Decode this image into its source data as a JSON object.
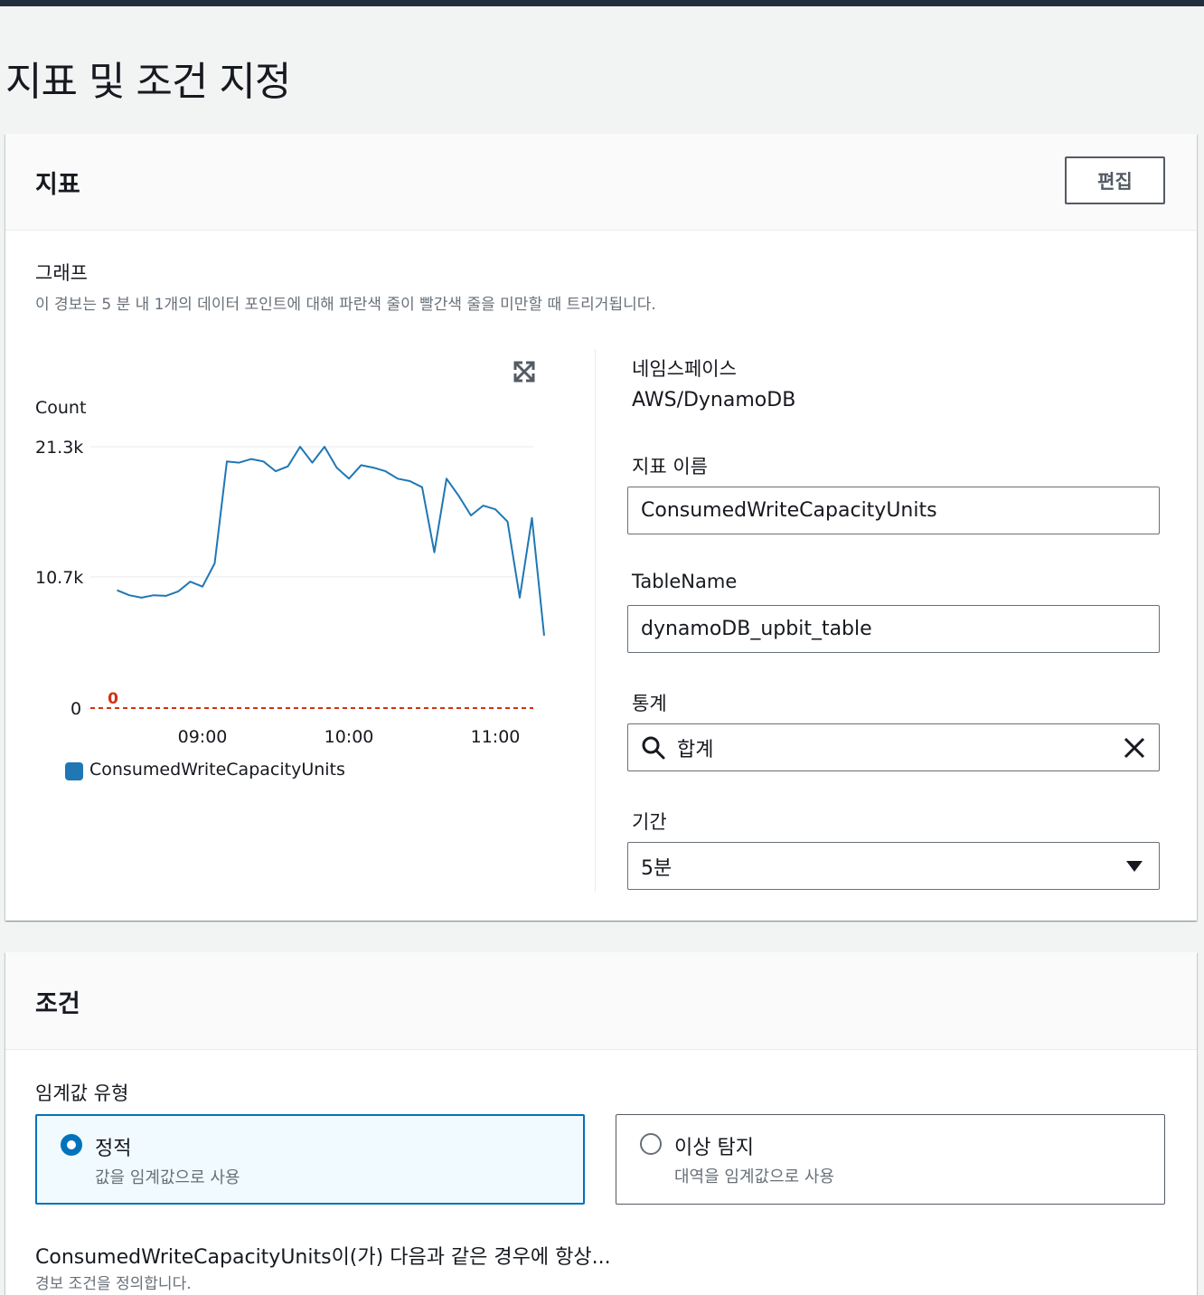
{
  "page": {
    "title": "지표 및 조건 지정"
  },
  "metric_panel": {
    "title": "지표",
    "edit_button": "편집",
    "graph_label": "그래프",
    "graph_description": "이 경보는 5 분 내 1개의 데이터 포인트에 대해 파란색 줄이 빨간색 줄을 미만할 때 트리거됩니다.",
    "expand_icon": "expand-icon",
    "namespace_label": "네임스페이스",
    "namespace_value": "AWS/DynamoDB",
    "metric_name_label": "지표 이름",
    "metric_name_value": "ConsumedWriteCapacityUnits",
    "table_name_label": "TableName",
    "table_name_value": "dynamoDB_upbit_table",
    "statistic_label": "통계",
    "statistic_value": "합계",
    "period_label": "기간",
    "period_value": "5분"
  },
  "chart_data": {
    "type": "line",
    "ylabel": "Count",
    "ytick_labels": [
      "21.3k",
      "10.7k",
      "0"
    ],
    "ylim": [
      0,
      21300
    ],
    "xtick_labels": [
      "09:00",
      "10:00",
      "11:00"
    ],
    "x_minutes_from_0800": [
      60,
      120,
      180
    ],
    "threshold": {
      "value": 0,
      "label": "0",
      "color": "#d13212"
    },
    "series": [
      {
        "name": "ConsumedWriteCapacityUnits",
        "color": "#1f77b4",
        "x_time": [
          "08:25",
          "08:30",
          "08:35",
          "08:40",
          "08:45",
          "08:50",
          "08:55",
          "09:00",
          "09:05",
          "09:10",
          "09:15",
          "09:20",
          "09:25",
          "09:30",
          "09:35",
          "09:40",
          "09:45",
          "09:50",
          "09:55",
          "10:00",
          "10:05",
          "10:10",
          "10:15",
          "10:20",
          "10:25",
          "10:30",
          "10:35",
          "10:40",
          "10:45",
          "10:50",
          "10:55",
          "11:00",
          "11:05",
          "11:10",
          "11:15",
          "11:20",
          "11:25",
          "11:30",
          "11:35"
        ],
        "values": [
          9600,
          9200,
          9000,
          9200,
          9150,
          9500,
          10300,
          9900,
          11800,
          20100,
          20000,
          20300,
          20100,
          19300,
          19700,
          21300,
          20000,
          21300,
          19600,
          18700,
          19800,
          19600,
          19300,
          18700,
          18500,
          18000,
          12700,
          18700,
          17300,
          15700,
          16500,
          16200,
          15200,
          9000,
          15500,
          5900
        ]
      }
    ]
  },
  "legend": {
    "series_name": "ConsumedWriteCapacityUnits",
    "color": "#1f77b4"
  },
  "condition_panel": {
    "title": "조건",
    "threshold_type_label": "임계값 유형",
    "options": [
      {
        "title": "정적",
        "desc": "값을 임계값으로 사용",
        "selected": true
      },
      {
        "title": "이상 탐지",
        "desc": "대역을 임계값으로 사용",
        "selected": false
      }
    ],
    "when_label": "ConsumedWriteCapacityUnits이(가) 다음과 같은 경우에 항상...",
    "when_desc": "경보 조건을 정의합니다."
  }
}
